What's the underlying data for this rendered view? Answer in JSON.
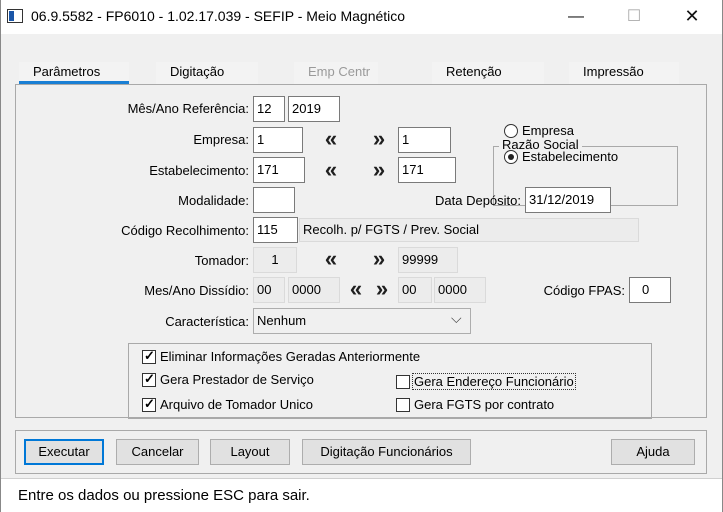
{
  "window": {
    "title": "06.9.5582 - FP6010 - 1.02.17.039 - SEFIP - Meio Magnético",
    "minimize_glyph": "—",
    "maximize_glyph": "☐",
    "close_glyph": "✕"
  },
  "tabs": [
    {
      "label": "Parâmetros",
      "state": "selected"
    },
    {
      "label": "Digitação",
      "state": "normal"
    },
    {
      "label": "Emp Centr",
      "state": "disabled"
    },
    {
      "label": "Retenção",
      "state": "normal"
    },
    {
      "label": "Impressão",
      "state": "normal"
    }
  ],
  "form": {
    "mes_ano_ref": {
      "label": "Mês/Ano Referência:",
      "month": "12",
      "year": "2019"
    },
    "empresa": {
      "label": "Empresa:",
      "from": "1",
      "to": "1"
    },
    "estabelecimento": {
      "label": "Estabelecimento:",
      "from": "171",
      "to": "171"
    },
    "modalidade": {
      "label": "Modalidade:",
      "value": ""
    },
    "data_deposito": {
      "label": "Data Depósito:",
      "value": "31/12/2019"
    },
    "codigo_recolhimento": {
      "label": "Código Recolhimento:",
      "value": "115",
      "description": "Recolh. p/ FGTS / Prev. Social"
    },
    "tomador": {
      "label": "Tomador:",
      "from": "1",
      "to": "99999"
    },
    "mes_ano_dissidio": {
      "label": "Mes/Ano Dissídio:",
      "from_month": "00",
      "from_year": "0000",
      "to_month": "00",
      "to_year": "0000"
    },
    "codigo_fpas": {
      "label": "Código FPAS:",
      "value": "0"
    },
    "caracteristica": {
      "label": "Característica:",
      "value": "Nenhum"
    },
    "prev_glyph": "«",
    "next_glyph": "»",
    "dropdown_glyph": "⌵"
  },
  "razao_social": {
    "title": "Razão Social",
    "options": [
      {
        "label": "Empresa",
        "selected": false
      },
      {
        "label": "Estabelecimento",
        "selected": true
      }
    ]
  },
  "options": [
    {
      "label": "Eliminar Informações Geradas Anteriormente",
      "checked": true
    },
    {
      "label": "Gera Prestador de Serviço",
      "checked": true
    },
    {
      "label": "Arquivo de Tomador Unico",
      "checked": true
    },
    {
      "label": "Gera Endereço Funcionário",
      "checked": false
    },
    {
      "label": "Gera FGTS por contrato",
      "checked": false
    }
  ],
  "buttons": {
    "executar": "Executar",
    "cancelar": "Cancelar",
    "layout": "Layout",
    "digitacao_funcionarios": "Digitação Funcionários",
    "ajuda": "Ajuda"
  },
  "status": "Entre os dados ou pressione ESC para sair.",
  "colors": {
    "accent": "#1a7fd4",
    "default_button_border": "#0078d7",
    "window_bg": "#f0f0f0"
  }
}
